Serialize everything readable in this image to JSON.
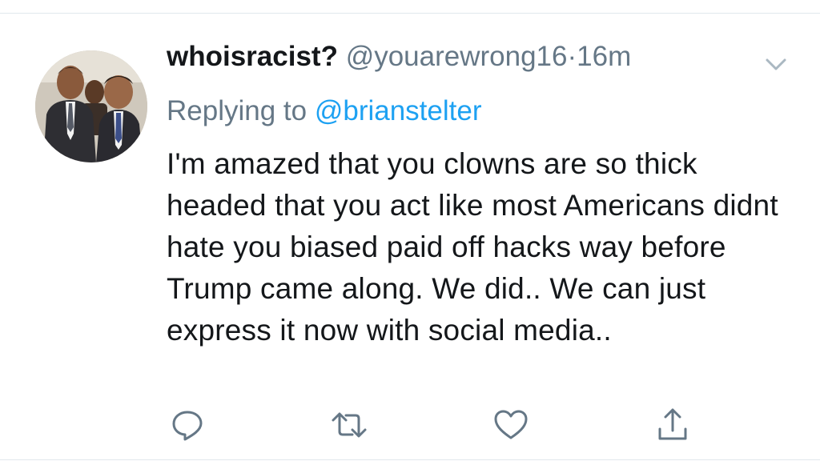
{
  "tweet": {
    "display_name": "whoisracist?",
    "handle": "@youarewrong16",
    "separator": "·",
    "time": "16m",
    "replying_prefix": "Replying to ",
    "replying_to": "@brianstelter",
    "body": "I'm amazed that you clowns are so thick headed that you act like most Americans didnt hate you biased paid off hacks way before Trump came along. We did.. We can just express it now with social media.."
  },
  "icons": {
    "more": "chevron-down-icon",
    "reply": "reply-icon",
    "retweet": "retweet-icon",
    "like": "heart-icon",
    "share": "share-icon"
  },
  "colors": {
    "text": "#14171a",
    "secondary": "#657786",
    "link": "#1da1f2",
    "icon": "#657786",
    "divider": "#e1e8ed"
  }
}
